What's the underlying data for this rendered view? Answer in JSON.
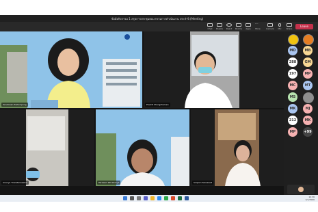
{
  "meeting": {
    "title": "ข้อมือกิจกรรม 1 สรุปการประชุมคณะกรรมการดำเนินงาน ประจำปี (Meeting)",
    "toolbar": [
      {
        "label": "Chat",
        "icon": "chat-icon"
      },
      {
        "label": "People",
        "icon": "people-icon"
      },
      {
        "label": "React",
        "icon": "react-icon"
      },
      {
        "label": "Rooms",
        "icon": "rooms-icon"
      },
      {
        "label": "Apps",
        "icon": "apps-icon"
      },
      {
        "label": "More",
        "icon": "more-icon"
      },
      {
        "label": "Camera",
        "icon": "camera-icon"
      },
      {
        "label": "Mic",
        "icon": "mic-icon"
      },
      {
        "label": "Share",
        "icon": "share-icon"
      }
    ],
    "leave_label": "Leave"
  },
  "participants": [
    {
      "name": "Kanokwan Pratompong"
    },
    {
      "name": "Prakrit Chongcharoen"
    },
    {
      "name": "Ananya Tiraratanasakul"
    },
    {
      "name": "Parawan Worakanya"
    },
    {
      "name": "Siriporn Suksawat"
    }
  ],
  "roster": [
    {
      "initials": "",
      "color": "#f1c40f",
      "photo": true
    },
    {
      "initials": "",
      "color": "#e67e22",
      "photo": true
    },
    {
      "initials": "MD",
      "color": "#a9c5f0"
    },
    {
      "initials": "MB",
      "color": "#f7d794"
    },
    {
      "initials": "288",
      "color": "#ffffff"
    },
    {
      "initials": "GM",
      "color": "#f7d794"
    },
    {
      "initials": "197",
      "color": "#ffffff"
    },
    {
      "initials": "MP",
      "color": "#f6b1b1"
    },
    {
      "initials": "MC",
      "color": "#f6b1b1"
    },
    {
      "initials": "MT",
      "color": "#a9c5f0"
    },
    {
      "initials": "MS",
      "color": "#b7e4b0"
    },
    {
      "initials": "",
      "color": "#8e8e8e",
      "photo": true
    },
    {
      "initials": "MK",
      "color": "#a9c5f0"
    },
    {
      "initials": "MJ",
      "color": "#f6b1b1"
    },
    {
      "initials": "212",
      "color": "#ffffff"
    },
    {
      "initials": "MK",
      "color": "#f6b1b1"
    },
    {
      "initials": "MP",
      "color": "#f6b1b1"
    },
    {
      "initials": "+99",
      "color": "#444444"
    }
  ],
  "clock": {
    "time": "10:36",
    "date": "3/1/2566"
  }
}
